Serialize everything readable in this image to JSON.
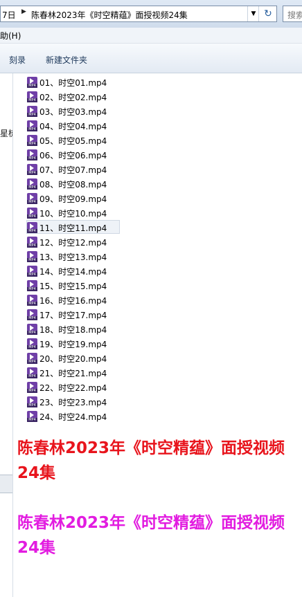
{
  "address_bar": {
    "segment_prefix": "7日",
    "separator": "▶",
    "current_folder": "陈春林2023年《时空精蕴》面授视频24集",
    "dropdown_glyph": "▼",
    "refresh_glyph": "↻",
    "search_placeholder": "搜索"
  },
  "menubar": {
    "help": "助(H)"
  },
  "toolbar": {
    "burn": "刻录",
    "new_folder": "新建文件夹"
  },
  "nav_pane": {
    "fragment": "星梳"
  },
  "files": [
    {
      "name": "01、时空01.mp4",
      "icon": "mp4-icon"
    },
    {
      "name": "02、时空02.mp4",
      "icon": "mp4-icon"
    },
    {
      "name": "03、时空03.mp4",
      "icon": "mp4-icon"
    },
    {
      "name": "04、时空04.mp4",
      "icon": "mp4-icon"
    },
    {
      "name": "05、时空05.mp4",
      "icon": "mp4-icon"
    },
    {
      "name": "06、时空06.mp4",
      "icon": "mp4-icon"
    },
    {
      "name": "07、时空07.mp4",
      "icon": "mp4-icon"
    },
    {
      "name": "08、时空08.mp4",
      "icon": "mp4-icon"
    },
    {
      "name": "09、时空09.mp4",
      "icon": "mp4-icon"
    },
    {
      "name": "10、时空10.mp4",
      "icon": "mp4-icon"
    },
    {
      "name": "11、时空11.mp4",
      "icon": "mp4-icon",
      "hovered": true
    },
    {
      "name": "12、时空12.mp4",
      "icon": "mp4-icon"
    },
    {
      "name": "13、时空13.mp4",
      "icon": "mp4-icon"
    },
    {
      "name": "14、时空14.mp4",
      "icon": "mp4-icon"
    },
    {
      "name": "15、时空15.mp4",
      "icon": "mp4-icon"
    },
    {
      "name": "16、时空16.mp4",
      "icon": "mp4-icon"
    },
    {
      "name": "17、时空17.mp4",
      "icon": "mp4-icon"
    },
    {
      "name": "18、时空18.mp4",
      "icon": "mp4-icon"
    },
    {
      "name": "19、时空19.mp4",
      "icon": "mp4-icon"
    },
    {
      "name": "20、时空20.mp4",
      "icon": "mp4-icon"
    },
    {
      "name": "21、时空21.mp4",
      "icon": "mp4-icon"
    },
    {
      "name": "22、时空22.mp4",
      "icon": "mp4-icon"
    },
    {
      "name": "23、时空23.mp4",
      "icon": "mp4-icon"
    },
    {
      "name": "24、时空24.mp4",
      "icon": "mp4-icon"
    }
  ],
  "icon_tag": "MP4",
  "overlay": {
    "red_text": "陈春林2023年《时空精蕴》面授视频24集",
    "pink_text": "陈春林2023年《时空精蕴》面授视频24集",
    "red_color": "#e8141c",
    "pink_color": "#e21ce0"
  }
}
